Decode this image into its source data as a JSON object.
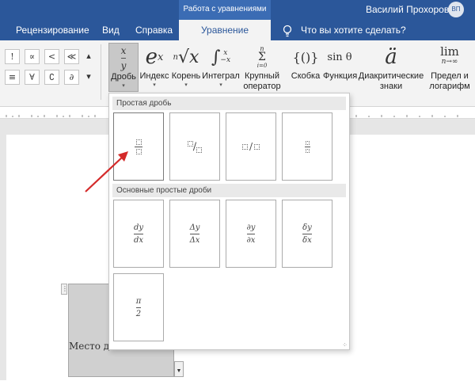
{
  "titlebar": {
    "context_tab": "Работа с уравнениями",
    "user_name": "Василий Прохоров",
    "avatar_initials": "ВП"
  },
  "tabs": {
    "review": "Рецензирование",
    "view": "Вид",
    "help": "Справка",
    "equation": "Уравнение",
    "tell_me": "Что вы хотите сделать?"
  },
  "symbols": [
    "!",
    "∝",
    "<",
    "≪",
    "≡",
    "∀",
    "∁",
    "∂"
  ],
  "ribbon": {
    "fraction": "Дробь",
    "script": "Индекс",
    "radical": "Корень",
    "integral": "Интеграл",
    "large_operator_1": "Крупный",
    "large_operator_2": "оператор",
    "bracket": "Скобка",
    "function": "Функция",
    "accent_1": "Диакритические",
    "accent_2": "знаки",
    "limit_1": "Предел и",
    "limit_2": "логарифм",
    "limit_icon_top": "lim",
    "limit_icon_bottom": "n→∞",
    "function_icon": "sin θ",
    "bracket_icon": "{()}"
  },
  "panel": {
    "section_simple": "Простая дробь",
    "section_common": "Основные простые дроби",
    "common": [
      {
        "num": "dy",
        "den": "dx"
      },
      {
        "num": "Δy",
        "den": "Δx"
      },
      {
        "num": "∂y",
        "den": "∂x"
      },
      {
        "num": "δy",
        "den": "δx"
      },
      {
        "num": "π",
        "den": "2"
      }
    ]
  },
  "document": {
    "equation_placeholder": "Место дл"
  },
  "colors": {
    "accent": "#2b579a",
    "arrow": "#d42a2a"
  }
}
